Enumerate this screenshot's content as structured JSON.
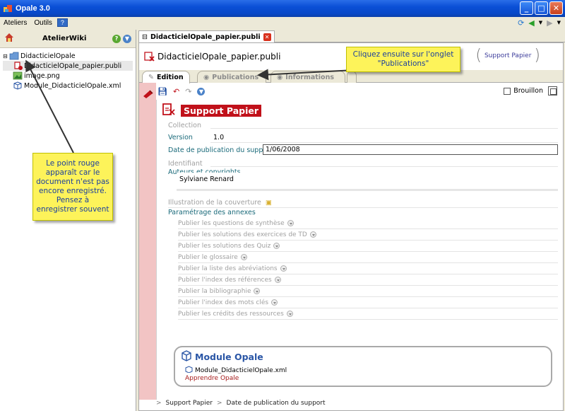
{
  "window": {
    "title": "Opale 3.0"
  },
  "menu": {
    "items": [
      "Ateliers",
      "Outils"
    ],
    "help_label": "?"
  },
  "left_panel": {
    "workshop_title": "AtelierWiki",
    "tree": [
      {
        "label": "DidacticielOpale",
        "type": "folder"
      },
      {
        "label": "DidacticielOpale_papier.publi",
        "type": "publi"
      },
      {
        "label": "image.png",
        "type": "image"
      },
      {
        "label": "Module_DidacticielOpale.xml",
        "type": "module"
      }
    ]
  },
  "editor_tab": {
    "label": "DidacticielOpale_papier.publi"
  },
  "doc_header": {
    "name": "DidacticielOpale_papier.publi",
    "badge": "Support Papier"
  },
  "subtabs": [
    "Edition",
    "Publications",
    "Informations"
  ],
  "toolbar": {
    "brouillon_label": "Brouillon"
  },
  "form": {
    "title": "Support Papier",
    "collection_label": "Collection",
    "version_label": "Version",
    "version_value": "1.0",
    "date_label": "Date de publication du support",
    "date_value": "1/06/2008",
    "identifiant_label": "Identifiant",
    "authors_label": "Auteurs et copyrights",
    "authors_value": "Sylviane Renard",
    "cover_label": "Illustration de la couverture",
    "annexes_label": "Paramétrage des annexes",
    "annexes": [
      "Publier les questions de synthèse",
      "Publier les solutions des exercices de TD",
      "Publier les solutions des Quiz",
      "Publier le glossaire",
      "Publier la liste des abréviations",
      "Publier l'index des références",
      "Publier la bibliographie",
      "Publier l'index des mots clés",
      "Publier les crédits des ressources"
    ]
  },
  "module": {
    "title": "Module Opale",
    "file": "Module_DidacticielOpale.xml",
    "subtitle": "Apprendre Opale"
  },
  "breadcrumb": [
    "Support Papier",
    "Date de publication du support"
  ],
  "callouts": {
    "publications": "Cliquez ensuite sur l'onglet \"Publications\"",
    "red_dot": "Le point rouge apparaît car le document n'est pas encore enregistré. Pensez à enregistrer souvent"
  },
  "colors": {
    "accent_red": "#c1111a",
    "callout_yellow": "#fdf35a",
    "callout_text": "#1b3f9e"
  }
}
